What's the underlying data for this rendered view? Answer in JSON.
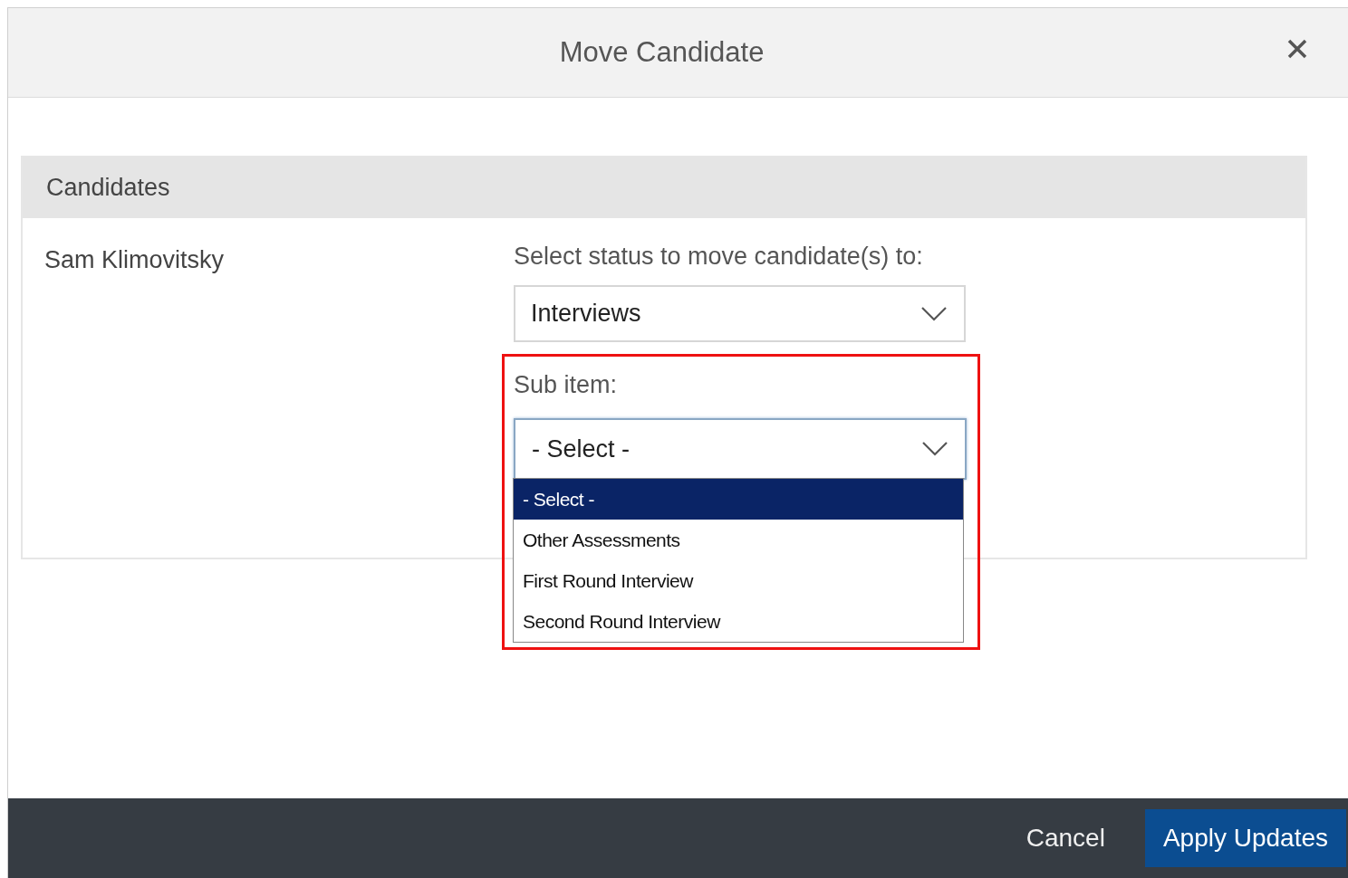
{
  "dialog": {
    "title": "Move Candidate"
  },
  "panel": {
    "header": "Candidates",
    "candidate": "Sam Klimovitsky",
    "status_label": "Select status to move candidate(s) to:",
    "status_select": {
      "value": "Interviews"
    },
    "sub_item_label": "Sub item:",
    "sub_item_select": {
      "value": "- Select -",
      "expanded": true,
      "options": [
        {
          "label": "- Select -",
          "selected": true
        },
        {
          "label": "Other Assessments",
          "selected": false
        },
        {
          "label": "First Round Interview",
          "selected": false
        },
        {
          "label": "Second Round Interview",
          "selected": false
        }
      ]
    }
  },
  "footer": {
    "buttons": [
      {
        "label": "Cancel",
        "kind": "link"
      },
      {
        "label": "Apply Updates",
        "kind": "primary"
      }
    ]
  }
}
